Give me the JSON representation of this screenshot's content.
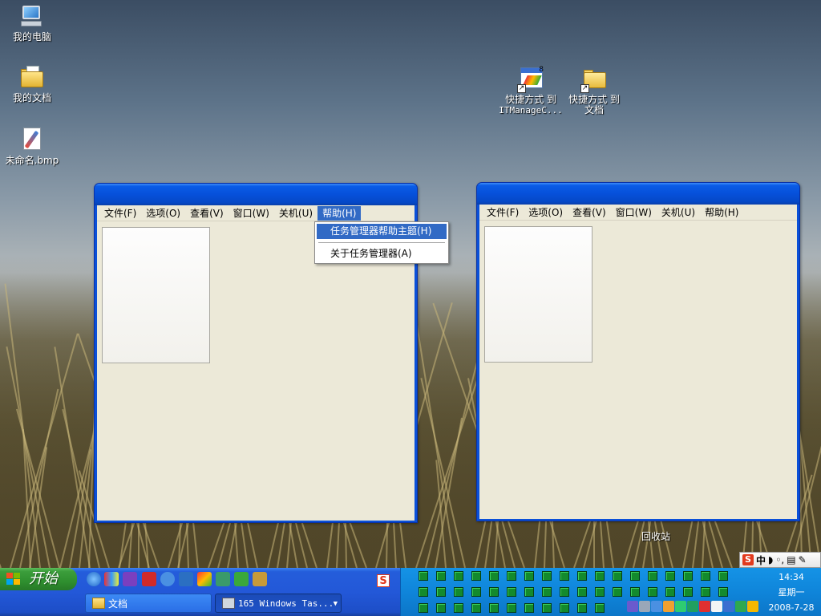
{
  "desktop": {
    "icons": [
      {
        "name": "my-computer",
        "label": "我的电脑"
      },
      {
        "name": "my-documents",
        "label": "我的文档"
      },
      {
        "name": "untitled-bmp",
        "label": "未命名.bmp"
      },
      {
        "name": "shortcut-itmanage",
        "label_line1": "快捷方式 到",
        "label_line2": "ITManageC..."
      },
      {
        "name": "shortcut-docs",
        "label_line1": "快捷方式 到",
        "label_line2": "文档"
      }
    ],
    "recycle_bin": "回收站",
    "itmanage_badge": "8"
  },
  "window_left": {
    "menu": [
      "文件(F)",
      "选项(O)",
      "查看(V)",
      "窗口(W)",
      "关机(U)",
      "帮助(H)"
    ]
  },
  "window_right": {
    "menu": [
      "文件(F)",
      "选项(O)",
      "查看(V)",
      "窗口(W)",
      "关机(U)",
      "帮助(H)"
    ]
  },
  "help_menu": {
    "items": [
      "任务管理器帮助主题(H)",
      "关于任务管理器(A)"
    ]
  },
  "ime": {
    "logo": "S",
    "mode": "中"
  },
  "taskbar": {
    "start_label": "开始",
    "buttons": [
      {
        "label": "文档"
      },
      {
        "label": "165 Windows Tas..."
      }
    ],
    "sogou": "S"
  },
  "clock": {
    "time": "14:34",
    "weekday": "星期一",
    "date": "2008-7-28"
  },
  "colors": {
    "taskbar": "#245ddb",
    "start": "#3c9e3c",
    "titlebar": "#0650da",
    "menu_highlight": "#316ac5",
    "tray": "#0f85da"
  }
}
